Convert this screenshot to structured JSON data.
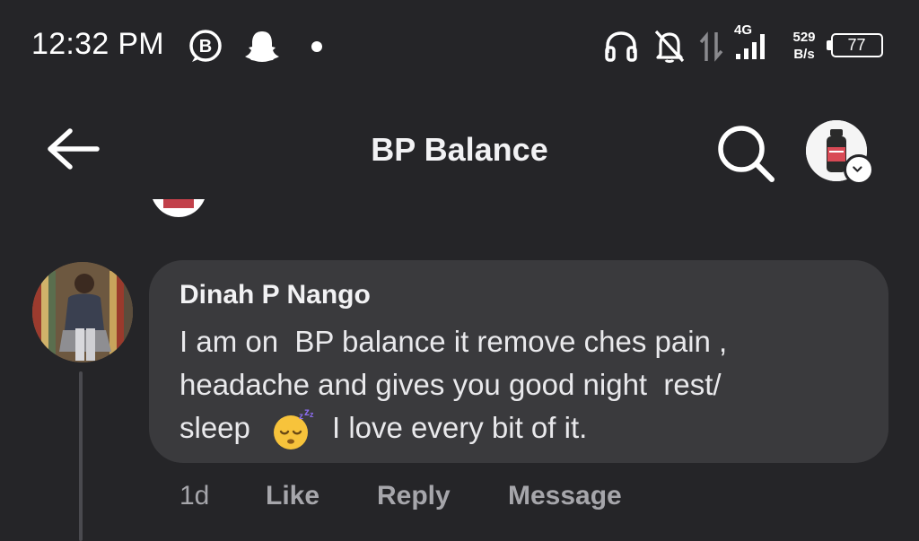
{
  "status_bar": {
    "time": "12:32 PM",
    "network": "4G",
    "speed_value": "529",
    "speed_unit": "B/s",
    "battery": "77"
  },
  "header": {
    "title": "BP Balance",
    "icons": [
      "back-arrow-icon",
      "search-icon",
      "page-avatar",
      "chevron-down-icon"
    ]
  },
  "comment": {
    "author": "Dinah P Nango",
    "lines": [
      "I am on  BP balance it remove ches pain ,",
      "headache and gives you good night  rest/",
      "sleep"
    ],
    "emoji": "sleepy-face-emoji",
    "line3_tail": "I love every bit of it.",
    "time": "1d",
    "actions": {
      "like": "Like",
      "reply": "Reply",
      "message": "Message"
    }
  },
  "colors": {
    "background": "#252528",
    "bubble": "#3a3a3d",
    "text": "#e9e9ec",
    "muted": "#a6a6ab"
  }
}
